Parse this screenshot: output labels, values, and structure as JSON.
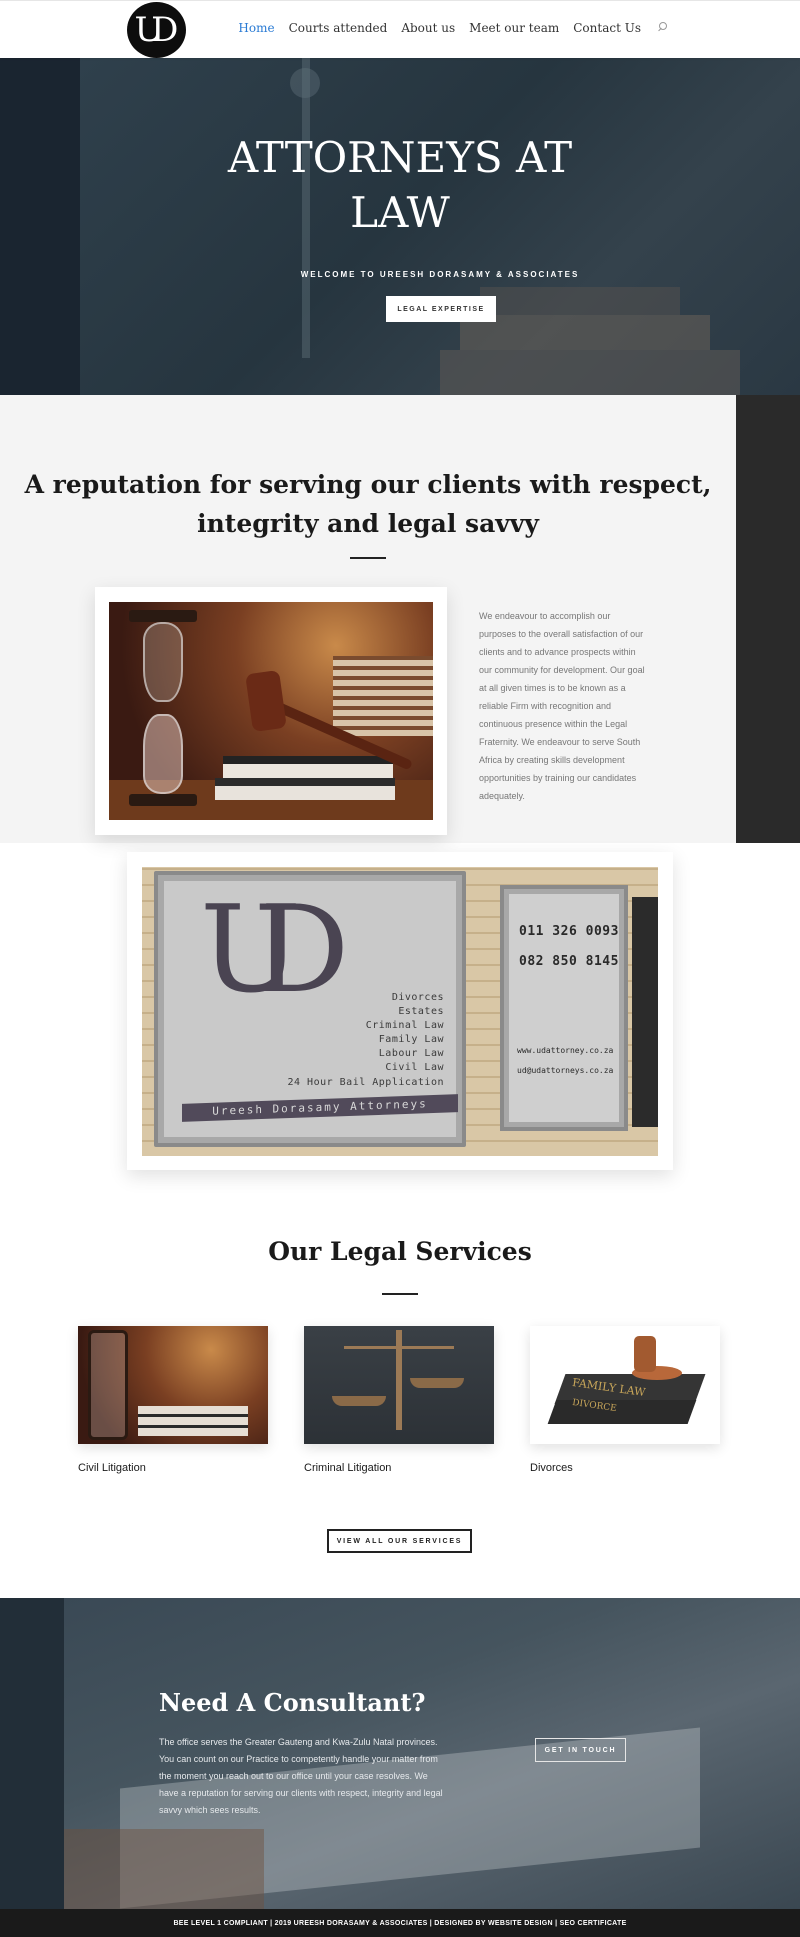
{
  "header": {
    "logo_text": "UD",
    "nav": [
      "Home",
      "Courts attended",
      "About us",
      "Meet our team",
      "Contact Us"
    ],
    "active_nav": "Home",
    "search_icon": "search-icon"
  },
  "hero": {
    "title_line1": "ATTORNEYS AT",
    "title_line2": "LAW",
    "subtitle": "WELCOME TO UREESH DORASAMY & ASSOCIATES",
    "button": "LEGAL EXPERTISE"
  },
  "reputation": {
    "title_line1": "A reputation for serving our clients with respect,",
    "title_line2": "integrity and legal savvy",
    "body": "We endeavour to accomplish our purposes to the overall satisfaction of our clients and to advance prospects within our community for development. Our goal at all given times is to be known as a reliable Firm with recognition and continuous presence within the Legal Fraternity. We endeavour to serve South Africa by creating skills development opportunities by training our candidates adequately."
  },
  "sign": {
    "logo": "UD",
    "services": [
      "Divorces",
      "Estates",
      "Criminal Law",
      "Family Law",
      "Labour Law",
      "Civil Law"
    ],
    "bail": "24 Hour Bail Application",
    "firm_name": "Ureesh Dorasamy Attorneys",
    "phone1": "011 326 0093",
    "phone2": "082 850 8145",
    "website": "www.udattorney.co.za",
    "email": "ud@udattorneys.co.za"
  },
  "services_section": {
    "title": "Our Legal Services",
    "cards": [
      {
        "label": "Civil Litigation"
      },
      {
        "label": "Criminal Litigation"
      },
      {
        "label": "Divorces",
        "book_text1": "FAMILY LAW",
        "book_text2": "DIVORCE"
      }
    ],
    "view_all_button": "VIEW ALL OUR SERVICES"
  },
  "consultant": {
    "title": "Need A Consultant?",
    "body": "The office serves the Greater Gauteng and Kwa-Zulu Natal provinces. You can count on our Practice to competently handle your matter from the moment you reach out to our office until your case resolves. We have a reputation for serving our clients with respect, integrity and legal savvy which sees results.",
    "button": "GET IN TOUCH"
  },
  "footer": {
    "text": "BEE LEVEL 1 COMPLIANT | 2019 UREESH DORASAMY & ASSOCIATES | DESIGNED BY WEBSITE DESIGN | SEO CERTIFICATE"
  },
  "colors": {
    "accent": "#2a7bd4",
    "hero_bg": "#1e2c37",
    "footer_bg": "#1a1a1a",
    "reputation_bg": "#f4f4f4"
  }
}
